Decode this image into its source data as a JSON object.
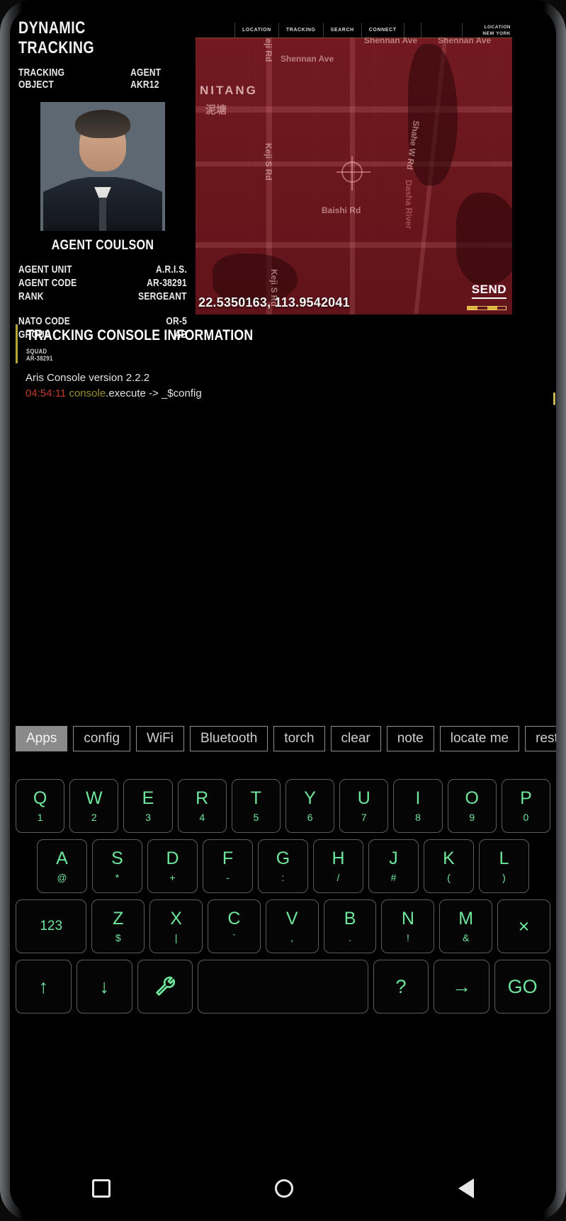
{
  "agent_panel": {
    "title": "DYNAMIC TRACKING",
    "subtitle_left": "TRACKING OBJECT",
    "subtitle_right": "AGENT AKR12",
    "agent_name": "AGENT COULSON",
    "stats": [
      {
        "key": "AGENT UNIT",
        "value": "A.R.I.S."
      },
      {
        "key": "AGENT CODE",
        "value": "AR-38291"
      },
      {
        "key": "RANK",
        "value": "SERGEANT"
      }
    ],
    "stats2": [
      {
        "key": "NATO CODE",
        "value": "OR-5"
      },
      {
        "key": "GROUP",
        "value": "AB"
      }
    ]
  },
  "map": {
    "nav": [
      "LOCATION",
      "TRACKING",
      "SEARCH",
      "CONNECT"
    ],
    "badge_label": "LOCATION",
    "badge_value": "NEW YORK",
    "coordinates": "22.5350163, 113.9542041",
    "send_label": "SEND",
    "labels": [
      "NITANG",
      "Shennan Ave",
      "Shennan Ave",
      "Shennan Ave",
      "Keji Rd",
      "Keji S Rd",
      "Keji S Rd",
      "Baishi Rd",
      "Shahe W Rd",
      "Dasha River"
    ],
    "cjk_label": "泥塘"
  },
  "console": {
    "title": "TRACKING CONSOLE INFORMATION",
    "squad_label": "SQUAD",
    "squad_code": "AR-38291",
    "lines": [
      {
        "version": "Aris Console version 2.2.2"
      },
      {
        "time": "04:54:11 ",
        "cmd": "console",
        "rest": ".execute -> _$config"
      }
    ]
  },
  "chips": [
    {
      "label": "Apps",
      "active": true
    },
    {
      "label": "config",
      "active": false
    },
    {
      "label": "WiFi",
      "active": false
    },
    {
      "label": "Bluetooth",
      "active": false
    },
    {
      "label": "torch",
      "active": false
    },
    {
      "label": "clear",
      "active": false
    },
    {
      "label": "note",
      "active": false
    },
    {
      "label": "locate me",
      "active": false
    },
    {
      "label": "restart",
      "active": false
    }
  ],
  "keyboard": {
    "row1": [
      {
        "main": "Q",
        "sub": "1"
      },
      {
        "main": "W",
        "sub": "2"
      },
      {
        "main": "E",
        "sub": "3"
      },
      {
        "main": "R",
        "sub": "4"
      },
      {
        "main": "T",
        "sub": "5"
      },
      {
        "main": "Y",
        "sub": "6"
      },
      {
        "main": "U",
        "sub": "7"
      },
      {
        "main": "I",
        "sub": "8"
      },
      {
        "main": "O",
        "sub": "9"
      },
      {
        "main": "P",
        "sub": "0"
      }
    ],
    "row2": [
      {
        "main": "A",
        "sub": "@"
      },
      {
        "main": "S",
        "sub": "*"
      },
      {
        "main": "D",
        "sub": "+"
      },
      {
        "main": "F",
        "sub": "-"
      },
      {
        "main": "G",
        "sub": ":"
      },
      {
        "main": "H",
        "sub": "/"
      },
      {
        "main": "J",
        "sub": "#"
      },
      {
        "main": "K",
        "sub": "("
      },
      {
        "main": "L",
        "sub": ")"
      }
    ],
    "row3": [
      {
        "main": "123",
        "sub": ""
      },
      {
        "main": "Z",
        "sub": "$"
      },
      {
        "main": "X",
        "sub": "|"
      },
      {
        "main": "C",
        "sub": "`"
      },
      {
        "main": "V",
        "sub": ","
      },
      {
        "main": "B",
        "sub": "."
      },
      {
        "main": "N",
        "sub": "!"
      },
      {
        "main": "M",
        "sub": "&"
      },
      {
        "main": "×",
        "sub": ""
      }
    ],
    "row4": [
      {
        "main": "↑",
        "name": "arrow-up-key"
      },
      {
        "main": "↓",
        "name": "arrow-down-key"
      },
      {
        "main": "🔧",
        "name": "wrench-key"
      },
      {
        "main": "",
        "name": "space-key"
      },
      {
        "main": "?",
        "name": "question-key"
      },
      {
        "main": "→",
        "name": "arrow-right-key"
      },
      {
        "main": "GO",
        "name": "go-key"
      }
    ]
  },
  "navbar": {
    "recents": "square",
    "home": "circle",
    "back": "triangle"
  },
  "colors": {
    "accent_green": "#6ee79c",
    "map_red": "#6d1b22",
    "console_yellow": "#b9a43c",
    "timestamp_red": "#c0392b"
  }
}
